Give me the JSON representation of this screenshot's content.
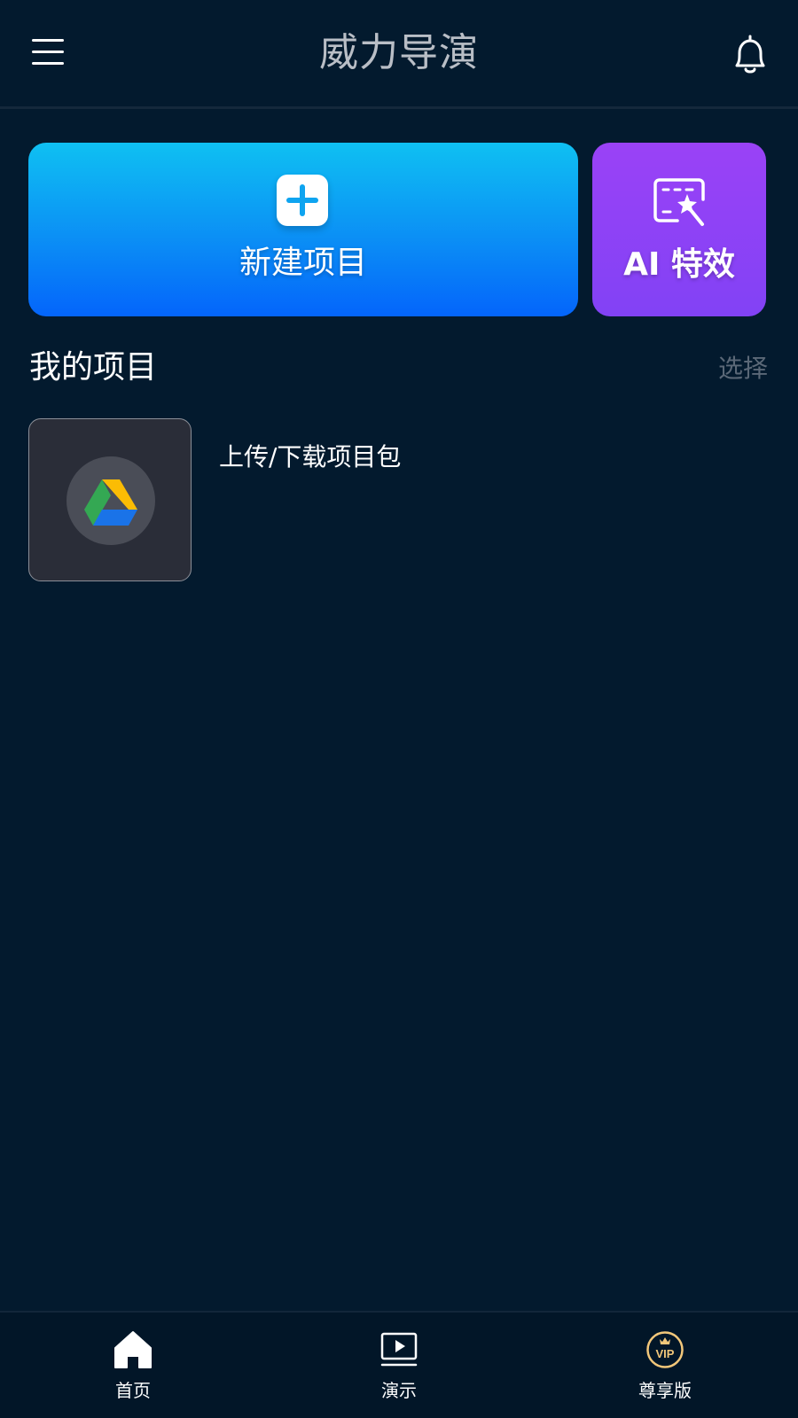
{
  "header": {
    "title": "威力导演",
    "menu_icon": "hamburger-menu-icon",
    "notification_icon": "bell-icon"
  },
  "actions": {
    "new_project": {
      "label": "新建项目",
      "icon": "plus-icon",
      "gradient": [
        "#0fc0f2",
        "#0465fb"
      ]
    },
    "ai_effects": {
      "label": "AI 特效",
      "icon": "ai-magic-wand-icon",
      "gradient": [
        "#9a42f6",
        "#8242f5"
      ]
    }
  },
  "my_projects": {
    "title": "我的项目",
    "select_label": "选择",
    "items": [
      {
        "name": "上传/下载项目包",
        "icon": "google-drive-icon"
      }
    ]
  },
  "bottom_nav": {
    "items": [
      {
        "label": "首页",
        "icon": "home-icon"
      },
      {
        "label": "演示",
        "icon": "play-screen-icon"
      },
      {
        "label": "尊享版",
        "icon": "vip-crown-icon"
      }
    ]
  },
  "colors": {
    "background": "#031a2e",
    "title_text": "#b9bec6",
    "muted_text": "#5b6877",
    "vip_gold": "#f2c77a"
  }
}
